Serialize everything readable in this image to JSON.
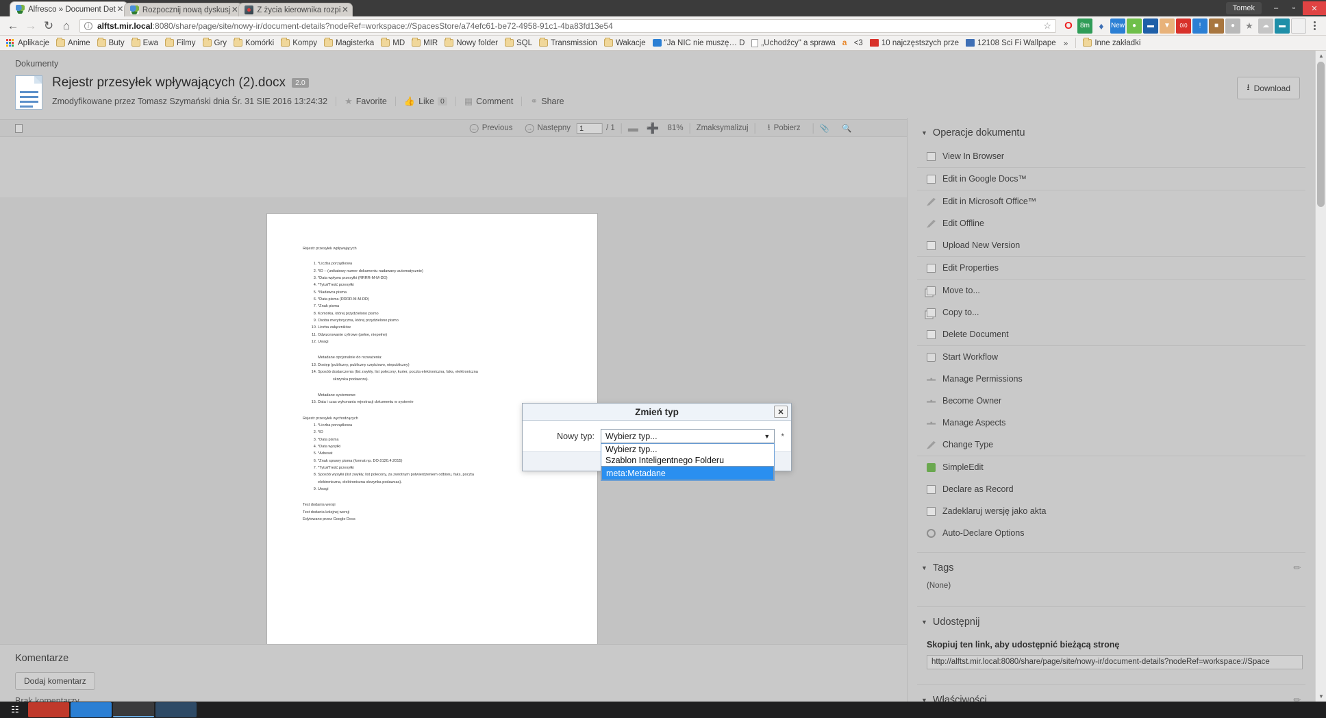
{
  "window": {
    "username": "Tomek",
    "controls": {
      "minimize": "–",
      "maximize": "▫",
      "close": "✕"
    }
  },
  "tabs": [
    {
      "title": "Alfresco » Document Det",
      "icon": "alfresco-favicon",
      "active": true,
      "close": "✕"
    },
    {
      "title": "Rozpocznij nową dyskusj",
      "icon": "alfresco-favicon",
      "active": false,
      "close": "✕"
    },
    {
      "title": "Z życia kierownika rozpi",
      "icon": "image-favicon",
      "active": false,
      "close": "✕"
    }
  ],
  "nav": {
    "back": "←",
    "forward": "→",
    "reload": "C",
    "home": "⌂",
    "menu": "kebab-menu",
    "url_host": "alftst.mir.local",
    "url_rest": ":8080/share/page/site/nowy-ir/document-details?nodeRef=workspace://SpacesStore/a74efc61-be72-4958-91c1-4ba83fd13e54",
    "star": "☆",
    "extension_badges": [
      "8m",
      "New",
      "0/0",
      "!"
    ]
  },
  "bookmarks": {
    "apps_label": "Aplikacje",
    "items": [
      {
        "label": "Anime",
        "icon": "folder-icon"
      },
      {
        "label": "Buty",
        "icon": "folder-icon"
      },
      {
        "label": "Ewa",
        "icon": "folder-icon"
      },
      {
        "label": "Filmy",
        "icon": "folder-icon"
      },
      {
        "label": "Gry",
        "icon": "folder-icon"
      },
      {
        "label": "Komórki",
        "icon": "folder-icon"
      },
      {
        "label": "Kompy",
        "icon": "folder-icon"
      },
      {
        "label": "Magisterka",
        "icon": "folder-icon"
      },
      {
        "label": "MD",
        "icon": "folder-icon"
      },
      {
        "label": "MIR",
        "icon": "folder-icon"
      },
      {
        "label": "Nowy folder",
        "icon": "folder-icon"
      },
      {
        "label": "SQL",
        "icon": "folder-icon"
      },
      {
        "label": "Transmission",
        "icon": "folder-icon"
      },
      {
        "label": "Wakacje",
        "icon": "folder-icon"
      },
      {
        "label": "\"Ja NIC nie muszę… D",
        "icon": "page-favicon"
      },
      {
        "label": "„Uchodźcy\" a sprawa",
        "icon": "document-icon"
      },
      {
        "label": "<3",
        "icon": "amazon-icon"
      },
      {
        "label": "10 najczęstszych prze",
        "icon": "red-favicon"
      },
      {
        "label": "12108 Sci Fi Wallpape",
        "icon": "blue-favicon"
      }
    ],
    "overflow": "»",
    "other_label": "Inne zakładki"
  },
  "breadcrumb": "Dokumenty",
  "document": {
    "title": "Rejestr przesyłek wpływających (2).docx",
    "version": "2.0",
    "modified": "Zmodyfikowane przez Tomasz Szymański dnia Śr. 31 SIE 2016 13:24:32",
    "actions": {
      "favorite": "Favorite",
      "like": "Like",
      "like_count": "0",
      "comment": "Comment",
      "share": "Share"
    },
    "download_button": "Download"
  },
  "viewer": {
    "previous": "Previous",
    "next": "Następny",
    "page_value": "1",
    "page_total": "/ 1",
    "zoom": "81%",
    "maximize": "Zmaksymalizuj",
    "download": "Pobierz",
    "attach_icon": "paperclip-icon",
    "search_icon": "search-icon"
  },
  "preview": {
    "heading1": "Rejestr przesyłek wpływających",
    "list1": [
      "*Liczba porządkowa",
      "*ID – (unikatowy numer dokumentu nadawany automatycznie)",
      "*Data wpływu przesyłki (RRRR-M-M-DD)",
      "*Tytuł/Treść przesyłki",
      "*Nadawca pisma",
      "*Data pisma (RRRR-M-M-DD)",
      "*Znak pisma",
      "Komórka, której przydzielono pismo",
      "Osoba merytoryczna, której przydzielono pismo",
      "Liczba załączników",
      "Odwzorowanie cyfrowe (pełne, niepełne)",
      "Uwagi"
    ],
    "heading2": "Metadane opcjonalnie do rozważenia:",
    "list2": [
      "Dostęp (publiczny, publiczny częściowo, niepubliczny)",
      "Sposób dostarczenia (list zwykły, list polecony, kurier, poczta elektroniczna, faks, elektroniczna"
    ],
    "list2_cont": "skrzynka podawcza).",
    "heading3": "Metadane systemowe:",
    "list3": [
      "Data i czas wykonania rejestracji dokumentu w systemie"
    ],
    "heading4": "Rejestr przesyłek wychodzących",
    "list4": [
      "*Liczba porządkowa",
      "*ID",
      "*Data pisma",
      "*Data wysyłki",
      "*Adresat",
      "*Znak sprawy pisma (format np. DO.0120.4.2015)",
      "*Tytuł/Treść przesyłki",
      "Sposób wysyłki (list zwykły, list polecony, za zwrotnym potwierdzeniem odbioru, faks, poczta"
    ],
    "list4_cont": "elektroniczna, elektroniczna skrzynka podawcza).",
    "list4_last": "Uwagi",
    "footer_lines": [
      "Test dodania wersji",
      "Test dodania kolejnej wersji",
      "Edytowano przez Google Docs"
    ]
  },
  "comments": {
    "heading": "Komentarze",
    "add_button": "Dodaj komentarz",
    "empty": "Brak komentarzy"
  },
  "sidebar": {
    "operations": {
      "title": "Operacje dokumentu",
      "items": [
        {
          "label": "View In Browser",
          "icon": "browser-window-icon",
          "divider": true
        },
        {
          "label": "Edit in Google Docs™",
          "icon": "edit-page-icon",
          "divider": true
        },
        {
          "label": "Edit in Microsoft Office™",
          "icon": "pencil-icon",
          "divider": false
        },
        {
          "label": "Edit Offline",
          "icon": "pencil-icon",
          "divider": false
        },
        {
          "label": "Upload New Version",
          "icon": "upload-document-icon",
          "divider": true
        },
        {
          "label": "Edit Properties",
          "icon": "properties-icon",
          "divider": true
        },
        {
          "label": "Move to...",
          "icon": "move-icon",
          "divider": false
        },
        {
          "label": "Copy to...",
          "icon": "copy-icon",
          "divider": false
        },
        {
          "label": "Delete Document",
          "icon": "delete-document-icon",
          "divider": true
        },
        {
          "label": "Start Workflow",
          "icon": "workflow-icon",
          "divider": false
        },
        {
          "label": "Manage Permissions",
          "icon": "key-icon",
          "divider": false
        },
        {
          "label": "Become Owner",
          "icon": "key-icon",
          "divider": false
        },
        {
          "label": "Manage Aspects",
          "icon": "key-icon",
          "divider": false
        },
        {
          "label": "Change Type",
          "icon": "pencil-icon",
          "divider": true
        },
        {
          "label": "SimpleEdit",
          "icon": "green-pencil-icon",
          "divider": false
        },
        {
          "label": "Declare as Record",
          "icon": "record-icon",
          "divider": false
        },
        {
          "label": "Zadeklaruj wersję jako akta",
          "icon": "record-icon",
          "divider": false
        },
        {
          "label": "Auto-Declare Options",
          "icon": "gear-icon",
          "divider": false
        }
      ]
    },
    "tags": {
      "title": "Tags",
      "value": "(None)",
      "edit_icon": "pencil-icon"
    },
    "share": {
      "title": "Udostępnij",
      "label": "Skopiuj ten link, aby udostępnić bieżącą stronę",
      "link": "http://alftst.mir.local:8080/share/page/site/nowy-ir/document-details?nodeRef=workspace://Space"
    },
    "properties": {
      "title": "Właściwości",
      "edit_icon": "pencil-icon"
    }
  },
  "modal": {
    "title": "Zmień typ",
    "close": "✕",
    "field_label": "Nowy typ:",
    "selected_value": "Wybierz typ...",
    "required_marker": "*",
    "caret": "▼",
    "options": [
      {
        "label": "Wybierz typ...",
        "selected": false
      },
      {
        "label": "Szablon Inteligentnego Folderu",
        "selected": false
      },
      {
        "label": "meta:Metadane",
        "selected": true
      }
    ]
  },
  "colors": {
    "accent": "#2a8ff0",
    "page_bg": "#c9c9c9",
    "chrome_bg": "#f2f1f0",
    "titlebar": "#3b3b3b",
    "close_red": "#e04343"
  }
}
